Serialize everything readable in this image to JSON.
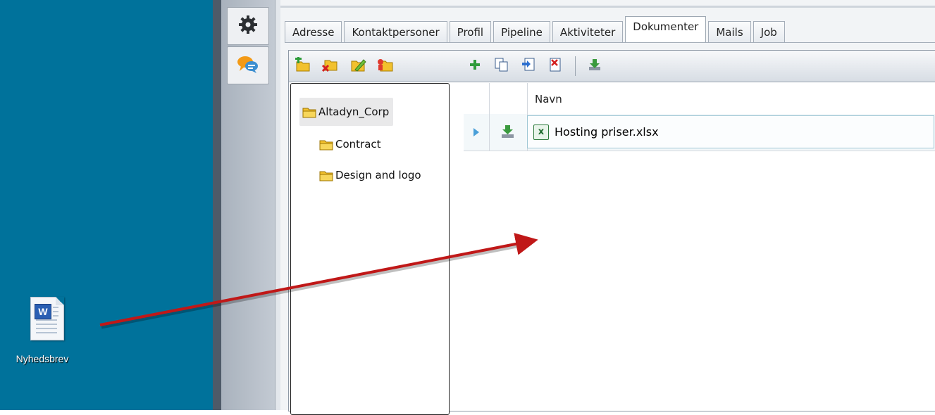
{
  "desktop": {
    "icon_label": "Nyhedsbrev",
    "background_color": "#00729b"
  },
  "sidebar": {
    "buttons": [
      {
        "icon": "gear-icon"
      },
      {
        "icon": "chat-bubbles-icon"
      }
    ]
  },
  "tabs": [
    {
      "label": "Adresse"
    },
    {
      "label": "Kontaktpersoner"
    },
    {
      "label": "Profil"
    },
    {
      "label": "Pipeline"
    },
    {
      "label": "Aktiviteter"
    },
    {
      "label": "Dokumenter",
      "active": true
    },
    {
      "label": "Mails"
    },
    {
      "label": "Job"
    }
  ],
  "toolbar": {
    "folder_actions": [
      "add-folder-icon",
      "delete-folder-icon",
      "edit-folder-icon",
      "folder-permissions-icon"
    ],
    "document_actions": [
      "add-document-icon",
      "copy-document-icon",
      "move-document-icon",
      "delete-document-icon",
      "download-icon"
    ]
  },
  "folder_tree": {
    "root": "Altadyn_Corp",
    "children": [
      "Contract",
      "Design and logo"
    ]
  },
  "documents": {
    "column_header": "Navn",
    "rows": [
      {
        "name": "Hosting priser.xlsx",
        "type_icon": "excel-file-icon"
      }
    ]
  },
  "annotation": {
    "arrow_color": "#c01818"
  }
}
